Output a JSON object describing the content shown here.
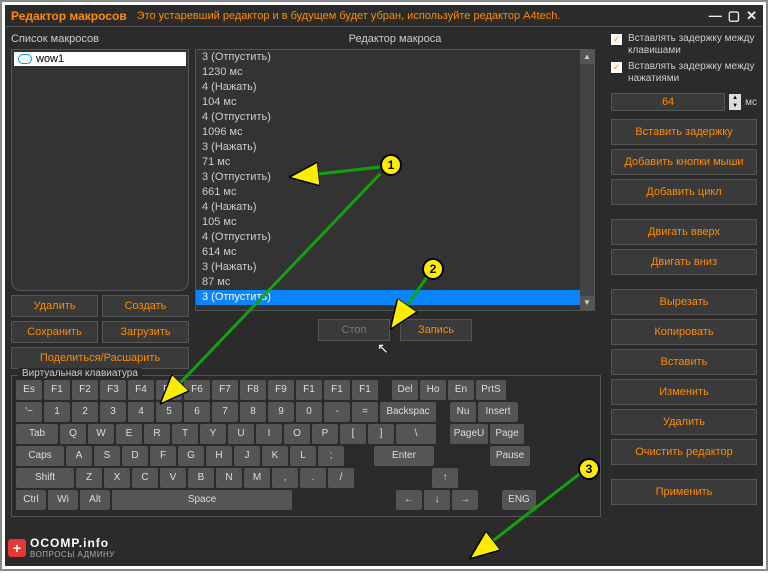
{
  "title": "Редактор макросов",
  "warning": "Это устаревший редактор и в будущем будет убран, используйте редактор A4tech.",
  "leftLabel": "Список макросов",
  "macroName": "wow1",
  "leftButtons": {
    "del": "Удалить",
    "create": "Создать",
    "save": "Сохранить",
    "load": "Загрузить",
    "share": "Поделиться/Расшарить"
  },
  "midLabel": "Редактор макроса",
  "lines": [
    "3 (Отпустить)",
    "1230 мс",
    "4 (Нажать)",
    "104 мс",
    "4 (Отпустить)",
    "1096 мс",
    "3 (Нажать)",
    "71 мс",
    "3 (Отпустить)",
    "661 мс",
    "4 (Нажать)",
    "105 мс",
    "4 (Отпустить)",
    "614 мс",
    "3 (Нажать)",
    "87 мс",
    "3 (Отпустить)"
  ],
  "selectedIndex": 16,
  "stopBtn": "Стоп",
  "recBtn": "Запись",
  "kbLegend": "Виртуальная клавиатура",
  "row1": [
    "Es",
    "F1",
    "F2",
    "F3",
    "F4",
    "F5",
    "F6",
    "F7",
    "F8",
    "F9",
    "F1",
    "F1",
    "F1",
    "",
    "Del",
    "Ho",
    "En",
    "PrtS"
  ],
  "row2": [
    "'~",
    "1",
    "2",
    "3",
    "4",
    "5",
    "6",
    "7",
    "8",
    "9",
    "0",
    "-",
    "=",
    "Backspac",
    "",
    "Nu",
    "Insert"
  ],
  "row3": [
    "Tab",
    "Q",
    "W",
    "E",
    "R",
    "T",
    "Y",
    "U",
    "I",
    "O",
    "P",
    "[",
    "]",
    "\\",
    "",
    "PageU",
    "Page"
  ],
  "row4": [
    "Caps",
    "A",
    "S",
    "D",
    "F",
    "G",
    "H",
    "J",
    "K",
    "L",
    ";",
    "",
    "Enter",
    "",
    "",
    "Pause"
  ],
  "row5": [
    "Shift",
    "Z",
    "X",
    "C",
    "V",
    "B",
    "N",
    "M",
    ",",
    ".",
    "/",
    "",
    "",
    "↑",
    ""
  ],
  "row6": [
    "Ctrl",
    "Wi",
    "Alt",
    "Space",
    "",
    "",
    "",
    "",
    "←",
    "↓",
    "→",
    "",
    "ENG"
  ],
  "right": {
    "chk1": "Вставлять задержку между клавишами",
    "chk2": "Вставлять задержку между нажатиями",
    "delayVal": "64",
    "unit": "мс",
    "btns": [
      "Вставить задержку",
      "Добавить кнопки мыши",
      "Добавить цикл",
      "Двигать вверх",
      "Двигать вниз",
      "Вырезать",
      "Копировать",
      "Вставить",
      "Изменить",
      "Удалить",
      "Очистить редактор",
      "Применить"
    ]
  },
  "watermark": {
    "site": "OCOMP.info",
    "sub": "ВОПРОСЫ АДМИНУ"
  }
}
